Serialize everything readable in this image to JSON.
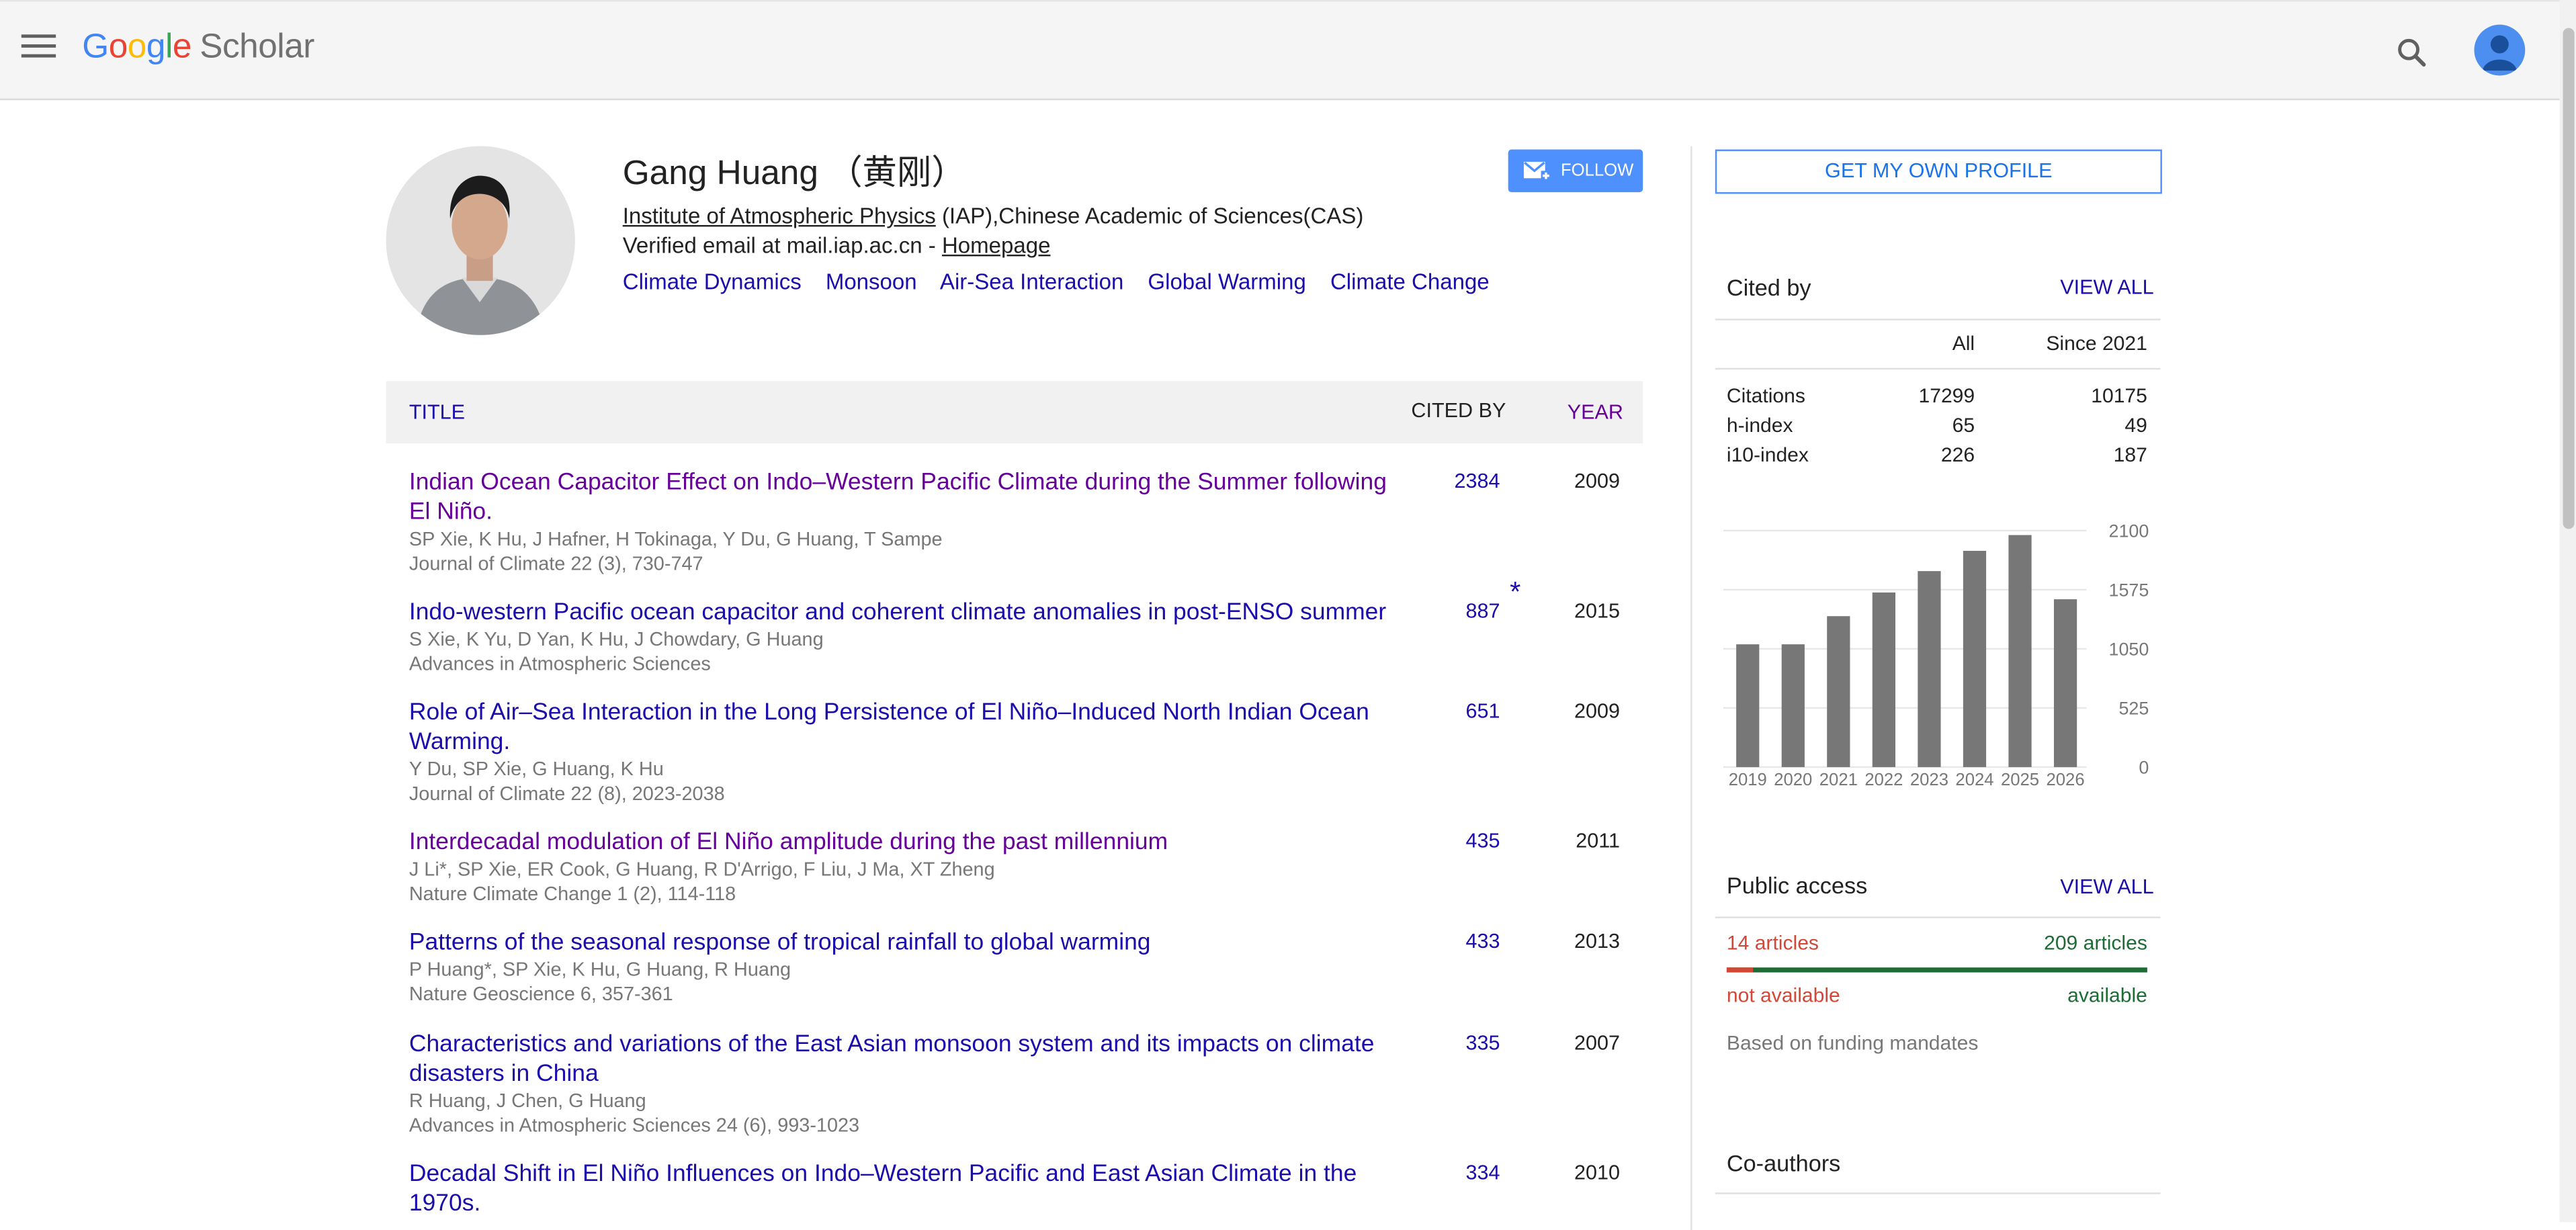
{
  "header": {
    "logo_letters": [
      "G",
      "o",
      "o",
      "g",
      "l",
      "e"
    ],
    "logo_suffix": "Scholar"
  },
  "profile": {
    "name": "Gang Huang （黄刚）",
    "affiliation_link": "Institute of Atmospheric Physics",
    "affiliation_rest": " (IAP),Chinese Academic of Sciences(CAS)",
    "email_text": "Verified email at mail.iap.ac.cn - ",
    "homepage_label": "Homepage",
    "interests": [
      "Climate Dynamics",
      "Monsoon",
      "Air-Sea Interaction",
      "Global Warming",
      "Climate Change"
    ],
    "follow_label": "FOLLOW"
  },
  "table": {
    "headers": {
      "title": "TITLE",
      "cited_by": "CITED BY",
      "year": "YEAR"
    },
    "articles": [
      {
        "title": "Indian Ocean Capacitor Effect on Indo–Western Pacific Climate during the Summer following El Niño.",
        "authors": "SP Xie, K Hu, J Hafner, H Tokinaga, Y Du, G Huang, T Sampe",
        "venue": "Journal of Climate 22 (3), 730-747",
        "cited": "2384",
        "star": "",
        "year": "2009",
        "visited": true
      },
      {
        "title": "Indo-western Pacific ocean capacitor and coherent climate anomalies in post-ENSO summer",
        "authors": "S Xie, K Yu, D Yan, K Hu, J Chowdary, G Huang",
        "venue": "Advances in Atmospheric Sciences",
        "cited": "887",
        "star": "*",
        "year": "2015",
        "visited": false
      },
      {
        "title": "Role of Air–Sea Interaction in the Long Persistence of El Niño–Induced North Indian Ocean Warming.",
        "authors": "Y Du, SP Xie, G Huang, K Hu",
        "venue": "Journal of Climate 22 (8), 2023-2038",
        "cited": "651",
        "star": "",
        "year": "2009",
        "visited": false
      },
      {
        "title": "Interdecadal modulation of El Niño amplitude during the past millennium",
        "authors": "J Li*, SP Xie, ER Cook, G Huang, R D'Arrigo, F Liu, J Ma, XT Zheng",
        "venue": "Nature Climate Change 1 (2), 114-118",
        "cited": "435",
        "star": "",
        "year": "2011",
        "visited": true
      },
      {
        "title": "Patterns of the seasonal response of tropical rainfall to global warming",
        "authors": "P Huang*, SP Xie, K Hu, G Huang, R Huang",
        "venue": "Nature Geoscience 6, 357-361",
        "cited": "433",
        "star": "",
        "year": "2013",
        "visited": false
      },
      {
        "title": "Characteristics and variations of the East Asian monsoon system and its impacts on climate disasters in China",
        "authors": "R Huang, J Chen, G Huang",
        "venue": "Advances in Atmospheric Sciences 24 (6), 993-1023",
        "cited": "335",
        "star": "",
        "year": "2007",
        "visited": false
      },
      {
        "title": "Decadal Shift in El Niño Influences on Indo–Western Pacific and East Asian Climate in the 1970s.",
        "authors": "",
        "venue": "",
        "cited": "334",
        "star": "",
        "year": "2010",
        "visited": false
      }
    ]
  },
  "sidebar": {
    "get_profile_label": "GET MY OWN PROFILE",
    "cited_by": {
      "title": "Cited by",
      "view_all": "VIEW ALL",
      "col_all": "All",
      "col_since": "Since 2021",
      "rows": [
        {
          "label": "Citations",
          "all": "17299",
          "since": "10175"
        },
        {
          "label": "h-index",
          "all": "65",
          "since": "49"
        },
        {
          "label": "i10-index",
          "all": "226",
          "since": "187"
        }
      ]
    },
    "public_access": {
      "title": "Public access",
      "view_all": "VIEW ALL",
      "not_available_count": "14 articles",
      "available_count": "209 articles",
      "not_available_label": "not available",
      "available_label": "available",
      "note": "Based on funding mandates",
      "not_available_fraction": 0.063
    },
    "coauthors_title": "Co-authors"
  },
  "chart_data": {
    "type": "bar",
    "categories": [
      "2019",
      "2020",
      "2021",
      "2022",
      "2023",
      "2024",
      "2025",
      "2026"
    ],
    "values": [
      1090,
      1090,
      1340,
      1550,
      1740,
      1920,
      2060,
      1490
    ],
    "yticks": [
      0,
      525,
      1050,
      1575,
      2100
    ],
    "ylim": [
      0,
      2100
    ],
    "color": "#777777"
  },
  "colors": {
    "link": "#1a0dab",
    "visited": "#660099",
    "follow_bg": "#4d90fe",
    "pa_red": "#d14836",
    "pa_green": "#1e6b35"
  }
}
